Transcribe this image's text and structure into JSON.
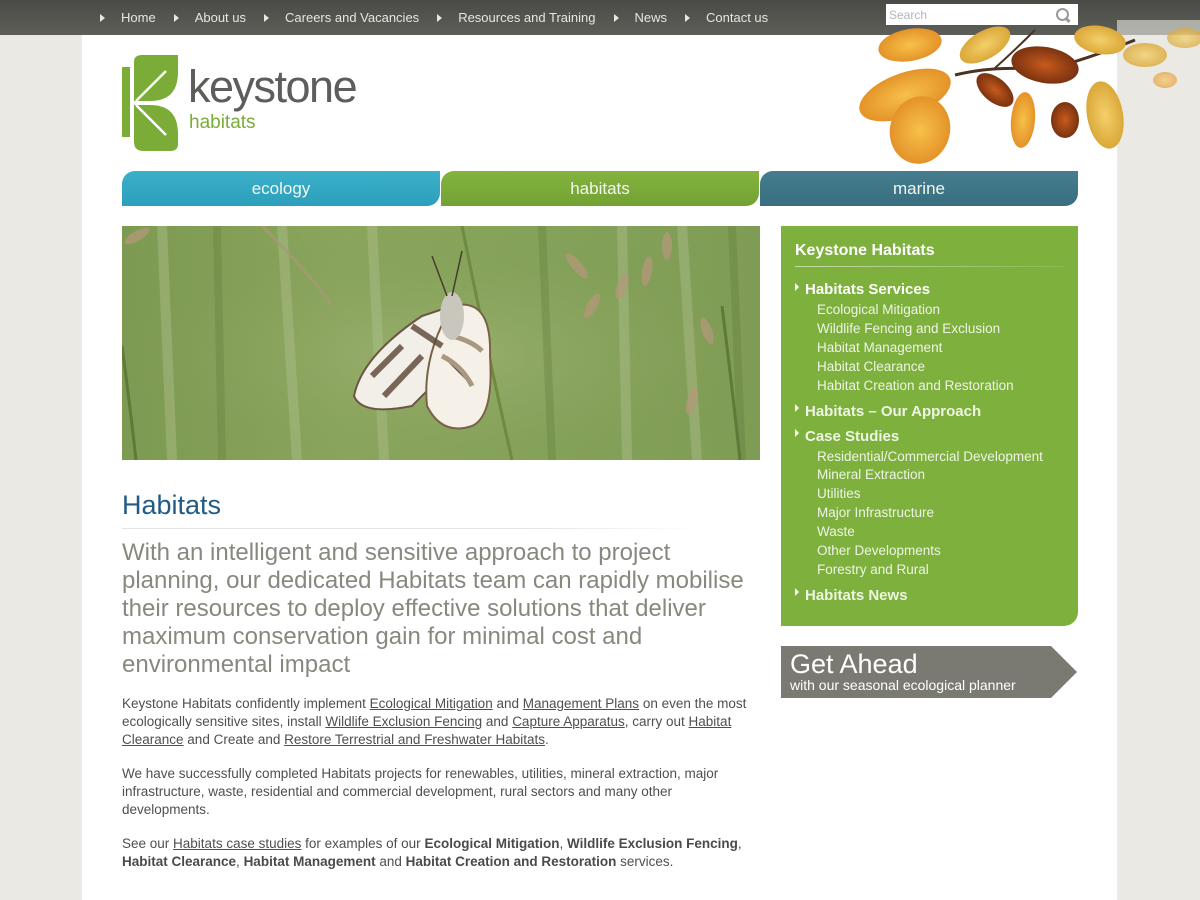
{
  "topnav": {
    "items": [
      {
        "label": "Home"
      },
      {
        "label": "About us"
      },
      {
        "label": "Careers and Vacancies"
      },
      {
        "label": "Resources and Training"
      },
      {
        "label": "News"
      },
      {
        "label": "Contact us"
      }
    ],
    "search": {
      "placeholder": "Search",
      "value": ""
    }
  },
  "logo": {
    "word1": "keystone",
    "word2": "habitats",
    "brand_green": "#7bac38"
  },
  "tabs": [
    {
      "label": "ecology",
      "color": "#33a7c3"
    },
    {
      "label": "habitats",
      "color": "#7bab39"
    },
    {
      "label": "marine",
      "color": "#3f7688"
    }
  ],
  "hero": {
    "alt": "Marbled white butterfly resting on grass stem"
  },
  "main": {
    "title": "Habitats",
    "lead": "With an intelligent and sensitive approach to project planning, our dedicated Habitats team can rapidly mobilise their resources to deploy effective solutions that deliver maximum conservation gain for minimal cost and environmental impact",
    "p1": {
      "t1": "Keystone Habitats confidently implement ",
      "l1": "Ecological Mitigation",
      "t2": " and ",
      "l2": "Management Plans",
      "t3": " on even the most ecologically sensitive sites, install ",
      "l3": "Wildlife Exclusion Fencing",
      "t4": " and ",
      "l4": "Capture Apparatus",
      "t5": ", carry out ",
      "l5": "Habitat Clearance",
      "t6": " and Create and ",
      "l6": "Restore Terrestrial and Freshwater Habitats",
      "t7": "."
    },
    "p2": "We have successfully completed Habitats projects for renewables, utilities, mineral extraction, major infrastructure, waste, residential and commercial development, rural sectors and many other developments.",
    "p3": {
      "t1": "See our ",
      "l1": "Habitats case studies",
      "t2": " for examples of our ",
      "b1": "Ecological Mitigation",
      "t3": ", ",
      "b2": "Wildlife Exclusion Fencing",
      "t4": ", ",
      "b3": "Habitat Clearance",
      "t5": ", ",
      "b4": "Habitat Management",
      "t6": " and ",
      "b5": "Habitat Creation and Restoration",
      "t7": " services."
    }
  },
  "sidebar": {
    "title": "Keystone Habitats",
    "groups": [
      {
        "label": "Habitats Services",
        "items": [
          "Ecological Mitigation",
          "Wildlife Fencing and Exclusion",
          "Habitat Management",
          "Habitat Clearance",
          "Habitat Creation and Restoration"
        ]
      },
      {
        "label": "Habitats – Our Approach",
        "items": []
      },
      {
        "label": "Case Studies",
        "items": [
          "Residential/Commercial Development",
          "Mineral Extraction",
          "Utilities",
          "Major Infrastructure",
          "Waste",
          "Other Developments",
          "Forestry and Rural"
        ]
      },
      {
        "label": "Habitats News",
        "items": []
      }
    ]
  },
  "banner": {
    "title": "Get Ahead",
    "subtitle": "with our seasonal ecological planner"
  }
}
